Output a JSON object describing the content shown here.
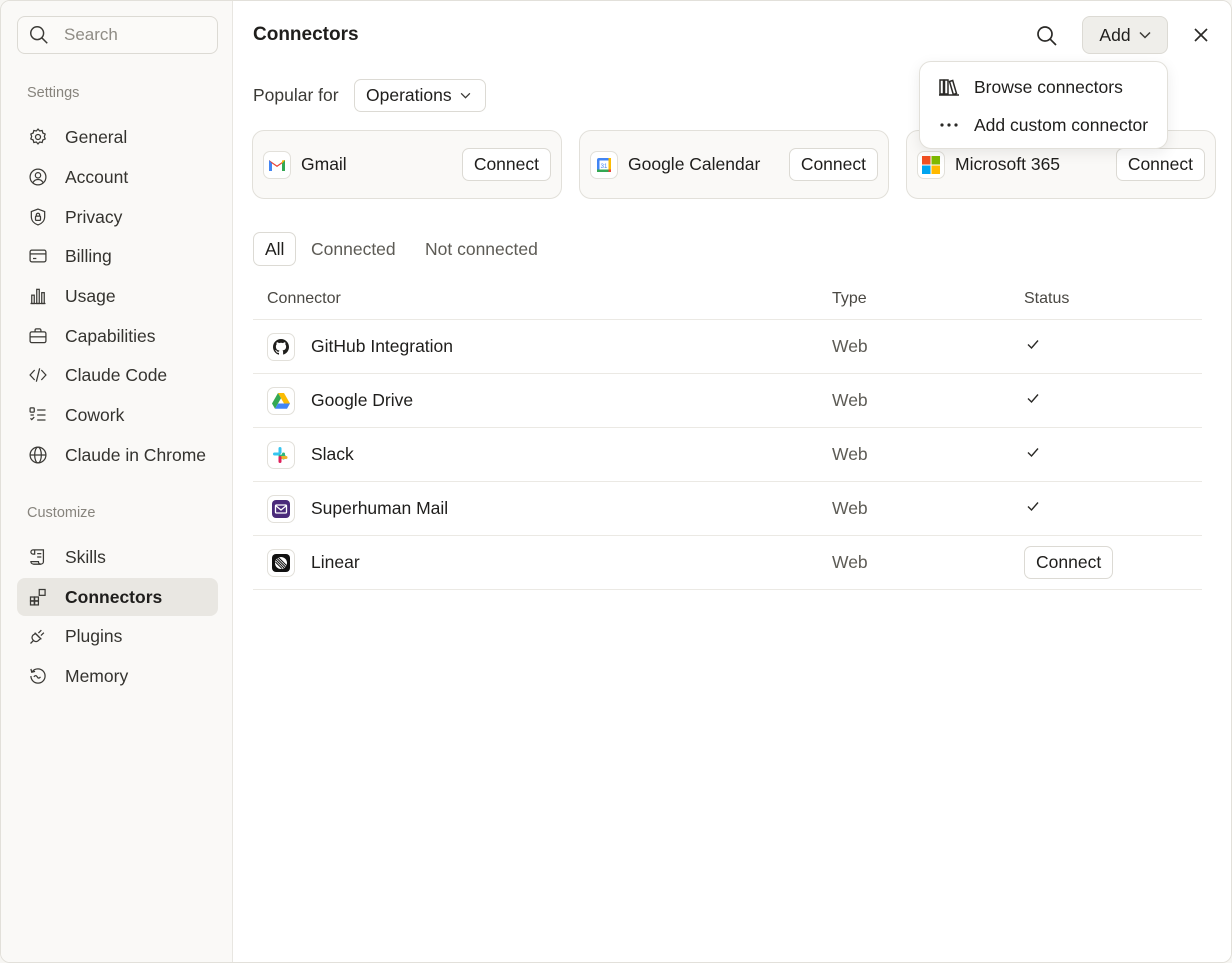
{
  "sidebar": {
    "search_placeholder": "Search",
    "sections": {
      "settings": "Settings",
      "customize": "Customize"
    },
    "settings_items": [
      {
        "label": "General",
        "icon": "gear-icon"
      },
      {
        "label": "Account",
        "icon": "user-circle-icon"
      },
      {
        "label": "Privacy",
        "icon": "shield-lock-icon"
      },
      {
        "label": "Billing",
        "icon": "credit-card-icon"
      },
      {
        "label": "Usage",
        "icon": "bar-chart-icon"
      },
      {
        "label": "Capabilities",
        "icon": "briefcase-icon"
      },
      {
        "label": "Claude Code",
        "icon": "code-icon"
      },
      {
        "label": "Cowork",
        "icon": "checklist-icon"
      },
      {
        "label": "Claude in Chrome",
        "icon": "globe-icon"
      }
    ],
    "customize_items": [
      {
        "label": "Skills",
        "icon": "scroll-icon"
      },
      {
        "label": "Connectors",
        "icon": "blocks-icon",
        "active": true
      },
      {
        "label": "Plugins",
        "icon": "plug-icon"
      },
      {
        "label": "Memory",
        "icon": "history-icon"
      }
    ]
  },
  "header": {
    "title": "Connectors",
    "add_label": "Add"
  },
  "add_menu": {
    "items": [
      {
        "label": "Browse connectors",
        "icon": "library-icon"
      },
      {
        "label": "Add custom connector",
        "icon": "more-horizontal-icon"
      }
    ]
  },
  "popular": {
    "label": "Popular for",
    "selected": "Operations",
    "cards": [
      {
        "name": "Gmail",
        "action": "Connect",
        "icon": "gmail-icon"
      },
      {
        "name": "Google Calendar",
        "action": "Connect",
        "icon": "google-calendar-icon"
      },
      {
        "name": "Microsoft 365",
        "action": "Connect",
        "icon": "microsoft-365-icon"
      }
    ]
  },
  "filters": {
    "tabs": [
      "All",
      "Connected",
      "Not connected"
    ],
    "active": "All"
  },
  "table": {
    "columns": [
      "Connector",
      "Type",
      "Status"
    ],
    "rows": [
      {
        "name": "GitHub Integration",
        "type": "Web",
        "status": "connected",
        "icon": "github-icon"
      },
      {
        "name": "Google Drive",
        "type": "Web",
        "status": "connected",
        "icon": "google-drive-icon"
      },
      {
        "name": "Slack",
        "type": "Web",
        "status": "connected",
        "icon": "slack-icon"
      },
      {
        "name": "Superhuman Mail",
        "type": "Web",
        "status": "connected",
        "icon": "superhuman-mail-icon"
      },
      {
        "name": "Linear",
        "type": "Web",
        "status": "not-connected",
        "action": "Connect",
        "icon": "linear-icon"
      }
    ]
  },
  "colors": {
    "sidebar_bg": "#faf9f7",
    "active_item_bg": "#e9e7e2",
    "border": "#e2e0da",
    "text": "#1f1e1c",
    "muted_text": "#87847d"
  }
}
